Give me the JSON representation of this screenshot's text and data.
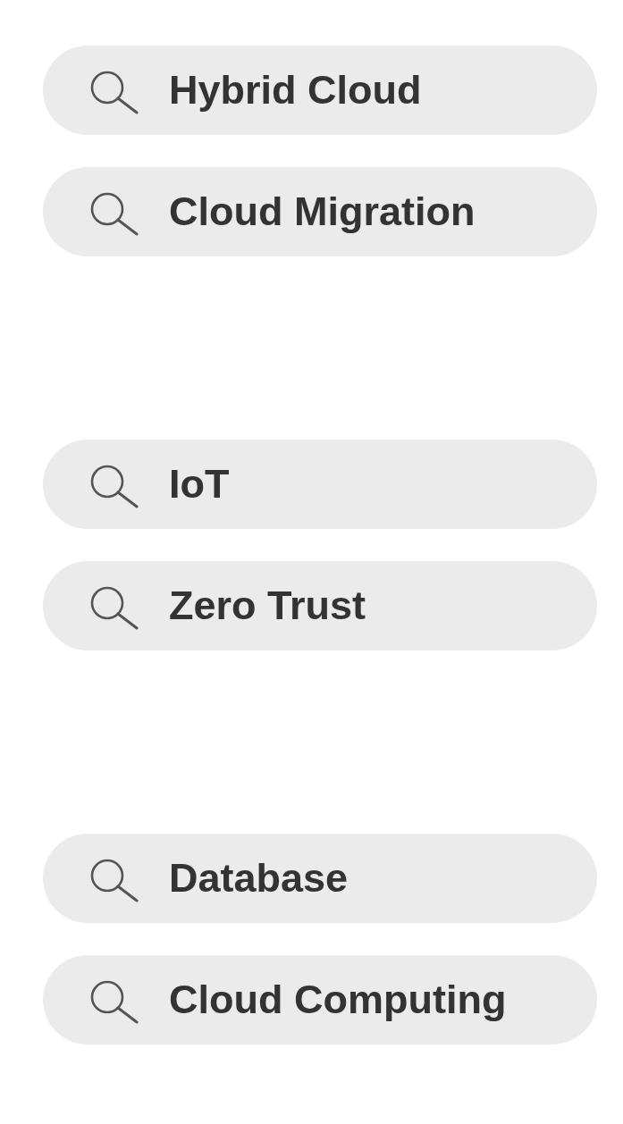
{
  "groups": [
    {
      "items": [
        {
          "label": "Hybrid Cloud"
        },
        {
          "label": "Cloud Migration"
        }
      ]
    },
    {
      "items": [
        {
          "label": "IoT"
        },
        {
          "label": "Zero Trust"
        }
      ]
    },
    {
      "items": [
        {
          "label": "Database"
        },
        {
          "label": "Cloud Computing"
        }
      ]
    }
  ]
}
